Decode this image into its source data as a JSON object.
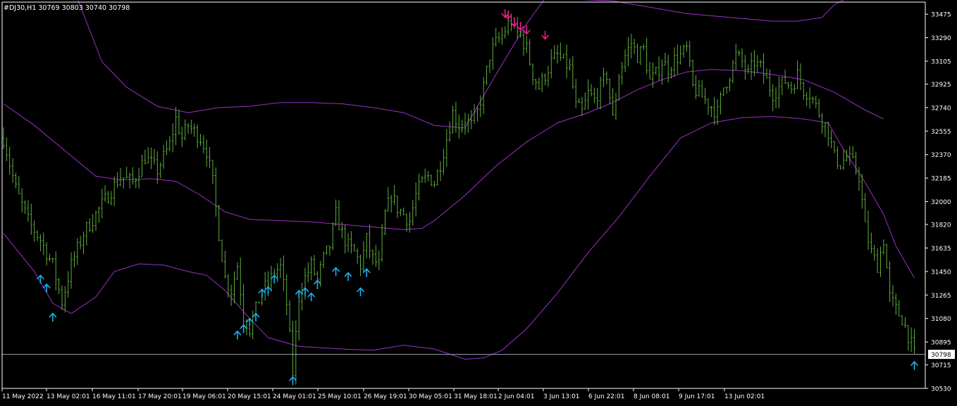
{
  "header": {
    "title": "#DJ30,H1  30769 30803 30740 30798"
  },
  "chart_data": {
    "type": "bar",
    "symbol": "#DJ30",
    "timeframe": "H1",
    "ohlc": {
      "open": 30769,
      "high": 30803,
      "low": 30740,
      "close": 30798
    },
    "current_price": 30798,
    "ylim": [
      30530,
      33570
    ],
    "y_ticks": [
      33475,
      33290,
      33105,
      32925,
      32740,
      32555,
      32370,
      32185,
      32000,
      31820,
      31635,
      31450,
      31265,
      31080,
      30895,
      30715,
      30530
    ],
    "x_ticks": [
      "11 May 2022",
      "13 May 02:01",
      "16 May 11:01",
      "17 May 20:01",
      "19 May 06:01",
      "20 May 15:01",
      "24 May 01:01",
      "25 May 10:01",
      "26 May 19:01",
      "30 May 05:01",
      "31 May 18:01",
      "2 Jun 04:01",
      "3 Jun 13:01",
      "6 Jun 22:01",
      "8 Jun 08:01",
      "9 Jun 17:01",
      "13 Jun 02:01"
    ],
    "price_path": [
      [
        0,
        32500
      ],
      [
        4,
        32100
      ],
      [
        8,
        31850
      ],
      [
        12,
        31700
      ],
      [
        16,
        31500
      ],
      [
        19,
        31210
      ],
      [
        22,
        31500
      ],
      [
        26,
        31750
      ],
      [
        30,
        31900
      ],
      [
        34,
        32050
      ],
      [
        38,
        32200
      ],
      [
        42,
        32150
      ],
      [
        46,
        32350
      ],
      [
        50,
        32250
      ],
      [
        54,
        32450
      ],
      [
        56,
        32650
      ],
      [
        58,
        32500
      ],
      [
        60,
        32600
      ],
      [
        62,
        32550
      ],
      [
        64,
        32500
      ],
      [
        66,
        32400
      ],
      [
        68,
        32150
      ],
      [
        70,
        31750
      ],
      [
        72,
        31400
      ],
      [
        74,
        31300
      ],
      [
        76,
        31500
      ],
      [
        78,
        31100
      ],
      [
        80,
        31000
      ],
      [
        82,
        31150
      ],
      [
        84,
        31300
      ],
      [
        86,
        31350
      ],
      [
        88,
        31450
      ],
      [
        90,
        31480
      ],
      [
        92,
        31200
      ],
      [
        94,
        30650
      ],
      [
        96,
        31250
      ],
      [
        98,
        31400
      ],
      [
        100,
        31500
      ],
      [
        102,
        31380
      ],
      [
        104,
        31550
      ],
      [
        106,
        31650
      ],
      [
        108,
        31900
      ],
      [
        110,
        31750
      ],
      [
        112,
        31650
      ],
      [
        114,
        31600
      ],
      [
        116,
        31500
      ],
      [
        118,
        31700
      ],
      [
        120,
        31550
      ],
      [
        122,
        31500
      ],
      [
        124,
        31900
      ],
      [
        126,
        32050
      ],
      [
        128,
        31950
      ],
      [
        130,
        31900
      ],
      [
        132,
        31850
      ],
      [
        134,
        32050
      ],
      [
        136,
        32150
      ],
      [
        138,
        32200
      ],
      [
        140,
        32150
      ],
      [
        142,
        32300
      ],
      [
        144,
        32500
      ],
      [
        146,
        32700
      ],
      [
        148,
        32600
      ],
      [
        150,
        32650
      ],
      [
        152,
        32600
      ],
      [
        154,
        32700
      ],
      [
        156,
        32900
      ],
      [
        158,
        33150
      ],
      [
        160,
        33250
      ],
      [
        162,
        33300
      ],
      [
        164,
        33400
      ],
      [
        165,
        33420
      ],
      [
        166,
        33350
      ],
      [
        168,
        33300
      ],
      [
        170,
        33200
      ],
      [
        172,
        33000
      ],
      [
        174,
        32900
      ],
      [
        176,
        33000
      ],
      [
        178,
        33100
      ],
      [
        180,
        33150
      ],
      [
        182,
        33100
      ],
      [
        184,
        33050
      ],
      [
        186,
        32750
      ],
      [
        188,
        32700
      ],
      [
        190,
        32850
      ],
      [
        192,
        32800
      ],
      [
        194,
        32900
      ],
      [
        196,
        33000
      ],
      [
        198,
        32650
      ],
      [
        200,
        33000
      ],
      [
        202,
        33150
      ],
      [
        204,
        33250
      ],
      [
        206,
        33150
      ],
      [
        208,
        33200
      ],
      [
        210,
        32950
      ],
      [
        212,
        33000
      ],
      [
        214,
        33100
      ],
      [
        216,
        33050
      ],
      [
        218,
        33120
      ],
      [
        220,
        33150
      ],
      [
        222,
        33200
      ],
      [
        224,
        32900
      ],
      [
        226,
        32850
      ],
      [
        228,
        32800
      ],
      [
        230,
        32750
      ],
      [
        232,
        32700
      ],
      [
        234,
        32900
      ],
      [
        236,
        33000
      ],
      [
        238,
        33150
      ],
      [
        240,
        33100
      ],
      [
        242,
        33000
      ],
      [
        244,
        33100
      ],
      [
        246,
        33050
      ],
      [
        248,
        32950
      ],
      [
        250,
        32850
      ],
      [
        252,
        32900
      ],
      [
        254,
        32950
      ],
      [
        256,
        32900
      ],
      [
        258,
        33000
      ],
      [
        260,
        32880
      ],
      [
        262,
        32850
      ],
      [
        264,
        32750
      ],
      [
        266,
        32650
      ],
      [
        268,
        32550
      ],
      [
        270,
        32350
      ],
      [
        272,
        32300
      ],
      [
        274,
        32350
      ],
      [
        276,
        32300
      ],
      [
        278,
        32200
      ],
      [
        280,
        31800
      ],
      [
        282,
        31600
      ],
      [
        284,
        31500
      ],
      [
        286,
        31700
      ],
      [
        288,
        31250
      ],
      [
        290,
        31150
      ],
      [
        292,
        31080
      ],
      [
        294,
        30950
      ],
      [
        296,
        30798
      ]
    ],
    "series": [
      {
        "name": "",
        "role": "upper_band",
        "values": [
          [
            24,
            33600
          ],
          [
            32,
            33100
          ],
          [
            40,
            32900
          ],
          [
            50,
            32750
          ],
          [
            60,
            32700
          ],
          [
            70,
            32740
          ],
          [
            80,
            32750
          ],
          [
            90,
            32780
          ],
          [
            100,
            32780
          ],
          [
            110,
            32770
          ],
          [
            120,
            32740
          ],
          [
            130,
            32700
          ],
          [
            140,
            32600
          ],
          [
            150,
            32580
          ],
          [
            160,
            33000
          ],
          [
            170,
            33400
          ],
          [
            176,
            33600
          ],
          [
            198,
            33580
          ],
          [
            210,
            33530
          ],
          [
            222,
            33480
          ],
          [
            236,
            33450
          ],
          [
            250,
            33420
          ],
          [
            258,
            33420
          ],
          [
            266,
            33450
          ],
          [
            270,
            33550
          ],
          [
            274,
            33600
          ]
        ]
      },
      {
        "name": "",
        "role": "middle_band",
        "values": [
          [
            0,
            32770
          ],
          [
            10,
            32600
          ],
          [
            20,
            32400
          ],
          [
            30,
            32200
          ],
          [
            38,
            32170
          ],
          [
            48,
            32180
          ],
          [
            56,
            32160
          ],
          [
            64,
            32050
          ],
          [
            72,
            31920
          ],
          [
            80,
            31860
          ],
          [
            90,
            31850
          ],
          [
            100,
            31840
          ],
          [
            110,
            31820
          ],
          [
            120,
            31800
          ],
          [
            130,
            31780
          ],
          [
            136,
            31790
          ],
          [
            140,
            31850
          ],
          [
            150,
            32050
          ],
          [
            160,
            32280
          ],
          [
            170,
            32470
          ],
          [
            180,
            32620
          ],
          [
            190,
            32700
          ],
          [
            198,
            32780
          ],
          [
            206,
            32880
          ],
          [
            214,
            32960
          ],
          [
            222,
            33020
          ],
          [
            230,
            33040
          ],
          [
            240,
            33030
          ],
          [
            250,
            33000
          ],
          [
            260,
            32960
          ],
          [
            270,
            32860
          ],
          [
            280,
            32720
          ],
          [
            286,
            32650
          ]
        ]
      },
      {
        "name": "",
        "role": "lower_band",
        "values": [
          [
            0,
            31750
          ],
          [
            10,
            31450
          ],
          [
            16,
            31200
          ],
          [
            22,
            31120
          ],
          [
            30,
            31250
          ],
          [
            36,
            31450
          ],
          [
            44,
            31510
          ],
          [
            52,
            31500
          ],
          [
            60,
            31450
          ],
          [
            66,
            31420
          ],
          [
            72,
            31300
          ],
          [
            80,
            31080
          ],
          [
            86,
            30930
          ],
          [
            96,
            30860
          ],
          [
            110,
            30840
          ],
          [
            120,
            30830
          ],
          [
            130,
            30870
          ],
          [
            140,
            30840
          ],
          [
            150,
            30760
          ],
          [
            156,
            30770
          ],
          [
            162,
            30830
          ],
          [
            170,
            31000
          ],
          [
            180,
            31280
          ],
          [
            190,
            31600
          ],
          [
            200,
            31880
          ],
          [
            210,
            32200
          ],
          [
            220,
            32500
          ],
          [
            230,
            32620
          ],
          [
            240,
            32660
          ],
          [
            250,
            32670
          ],
          [
            260,
            32650
          ],
          [
            268,
            32620
          ],
          [
            272,
            32450
          ],
          [
            280,
            32150
          ],
          [
            286,
            31900
          ],
          [
            290,
            31650
          ],
          [
            296,
            31400
          ]
        ]
      }
    ],
    "up_arrows": [
      [
        12,
        31420
      ],
      [
        14,
        31350
      ],
      [
        16,
        31120
      ],
      [
        76,
        30980
      ],
      [
        78,
        31030
      ],
      [
        80,
        31080
      ],
      [
        82,
        31120
      ],
      [
        84,
        31310
      ],
      [
        86,
        31330
      ],
      [
        88,
        31420
      ],
      [
        94,
        30620
      ],
      [
        96,
        31300
      ],
      [
        98,
        31320
      ],
      [
        100,
        31280
      ],
      [
        102,
        31380
      ],
      [
        108,
        31480
      ],
      [
        112,
        31440
      ],
      [
        116,
        31320
      ],
      [
        118,
        31470
      ],
      [
        296,
        30740
      ]
    ],
    "down_arrows": [
      [
        163,
        33450
      ],
      [
        164,
        33440
      ],
      [
        166,
        33380
      ],
      [
        168,
        33350
      ],
      [
        170,
        33320
      ],
      [
        176,
        33280
      ]
    ],
    "colors": {
      "bars": "#5fae3c",
      "bands": "#9b30c8",
      "up_arrow": "#1ab0ea",
      "down_arrow": "#ee1e8a",
      "axis": "#ffffff",
      "price_line": "#9aa5b5",
      "background": "#000000"
    }
  }
}
